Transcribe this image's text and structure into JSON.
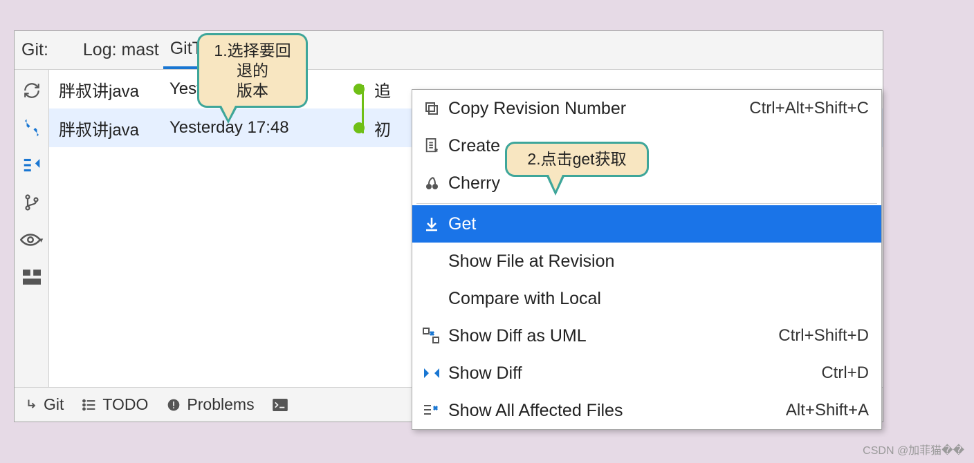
{
  "tabbar": {
    "git_label": "Git:",
    "tab1_prefix": "Log: mast",
    "tab2_label": "GitTest.java",
    "tab2_close": "×"
  },
  "commits": [
    {
      "author": "胖叔讲java",
      "date": "Yesterday 17:48",
      "subject": "追"
    },
    {
      "author": "胖叔讲java",
      "date": "Yesterday 17:48",
      "subject": "初"
    }
  ],
  "menu": {
    "copy_rev": {
      "label": "Copy Revision Number",
      "shortcut": "Ctrl+Alt+Shift+C"
    },
    "create": {
      "label": "Create"
    },
    "cherry": {
      "label": "Cherry"
    },
    "get": {
      "label": "Get"
    },
    "show_file": {
      "label": "Show File at Revision"
    },
    "compare": {
      "label": "Compare with Local"
    },
    "diff_uml": {
      "label": "Show Diff as UML",
      "shortcut": "Ctrl+Shift+D"
    },
    "show_diff": {
      "label": "Show Diff",
      "shortcut": "Ctrl+D"
    },
    "affected": {
      "label": "Show All Affected Files",
      "shortcut": "Alt+Shift+A"
    }
  },
  "bottombar": {
    "git": "Git",
    "todo": "TODO",
    "problems": "Problems"
  },
  "callouts": {
    "c1_line1": "1.选择要回退的",
    "c1_line2": "版本",
    "c2": "2.点击get获取"
  },
  "watermark": "CSDN @加菲猫��"
}
